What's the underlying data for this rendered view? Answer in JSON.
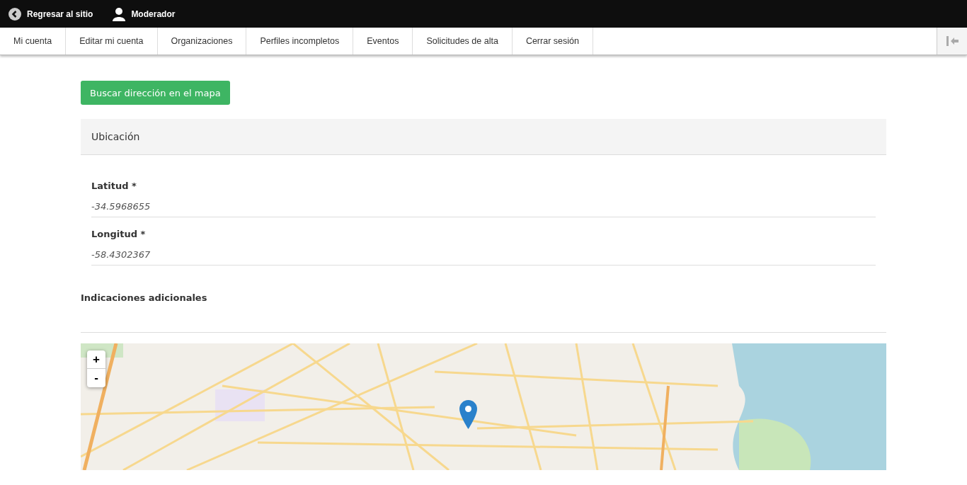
{
  "toolbar": {
    "back_link": "Regresar al sitio",
    "user": "Moderador"
  },
  "menu": [
    {
      "label": "Mi cuenta",
      "selected": false
    },
    {
      "label": "Editar mi cuenta",
      "selected": false
    },
    {
      "label": "Organizaciones",
      "selected": false
    },
    {
      "label": "Perfiles incompletos",
      "selected": false
    },
    {
      "label": "Eventos",
      "selected": false
    },
    {
      "label": "Solicitudes de alta",
      "selected": false
    },
    {
      "label": "Cerrar sesión",
      "selected": false
    }
  ],
  "search_button": "Buscar dirección en el mapa",
  "location_panel": {
    "title": "Ubicación",
    "fields": [
      {
        "label": "Latitud",
        "required_mark": "*",
        "value": "-34.5968655"
      },
      {
        "label": "Longitud",
        "required_mark": "*",
        "value": "-58.4302367"
      }
    ]
  },
  "additional_directions": {
    "label": "Indicaciones adicionales"
  },
  "map": {
    "kind": "picture",
    "zoom_in": "+",
    "zoom_out": "-"
  }
}
